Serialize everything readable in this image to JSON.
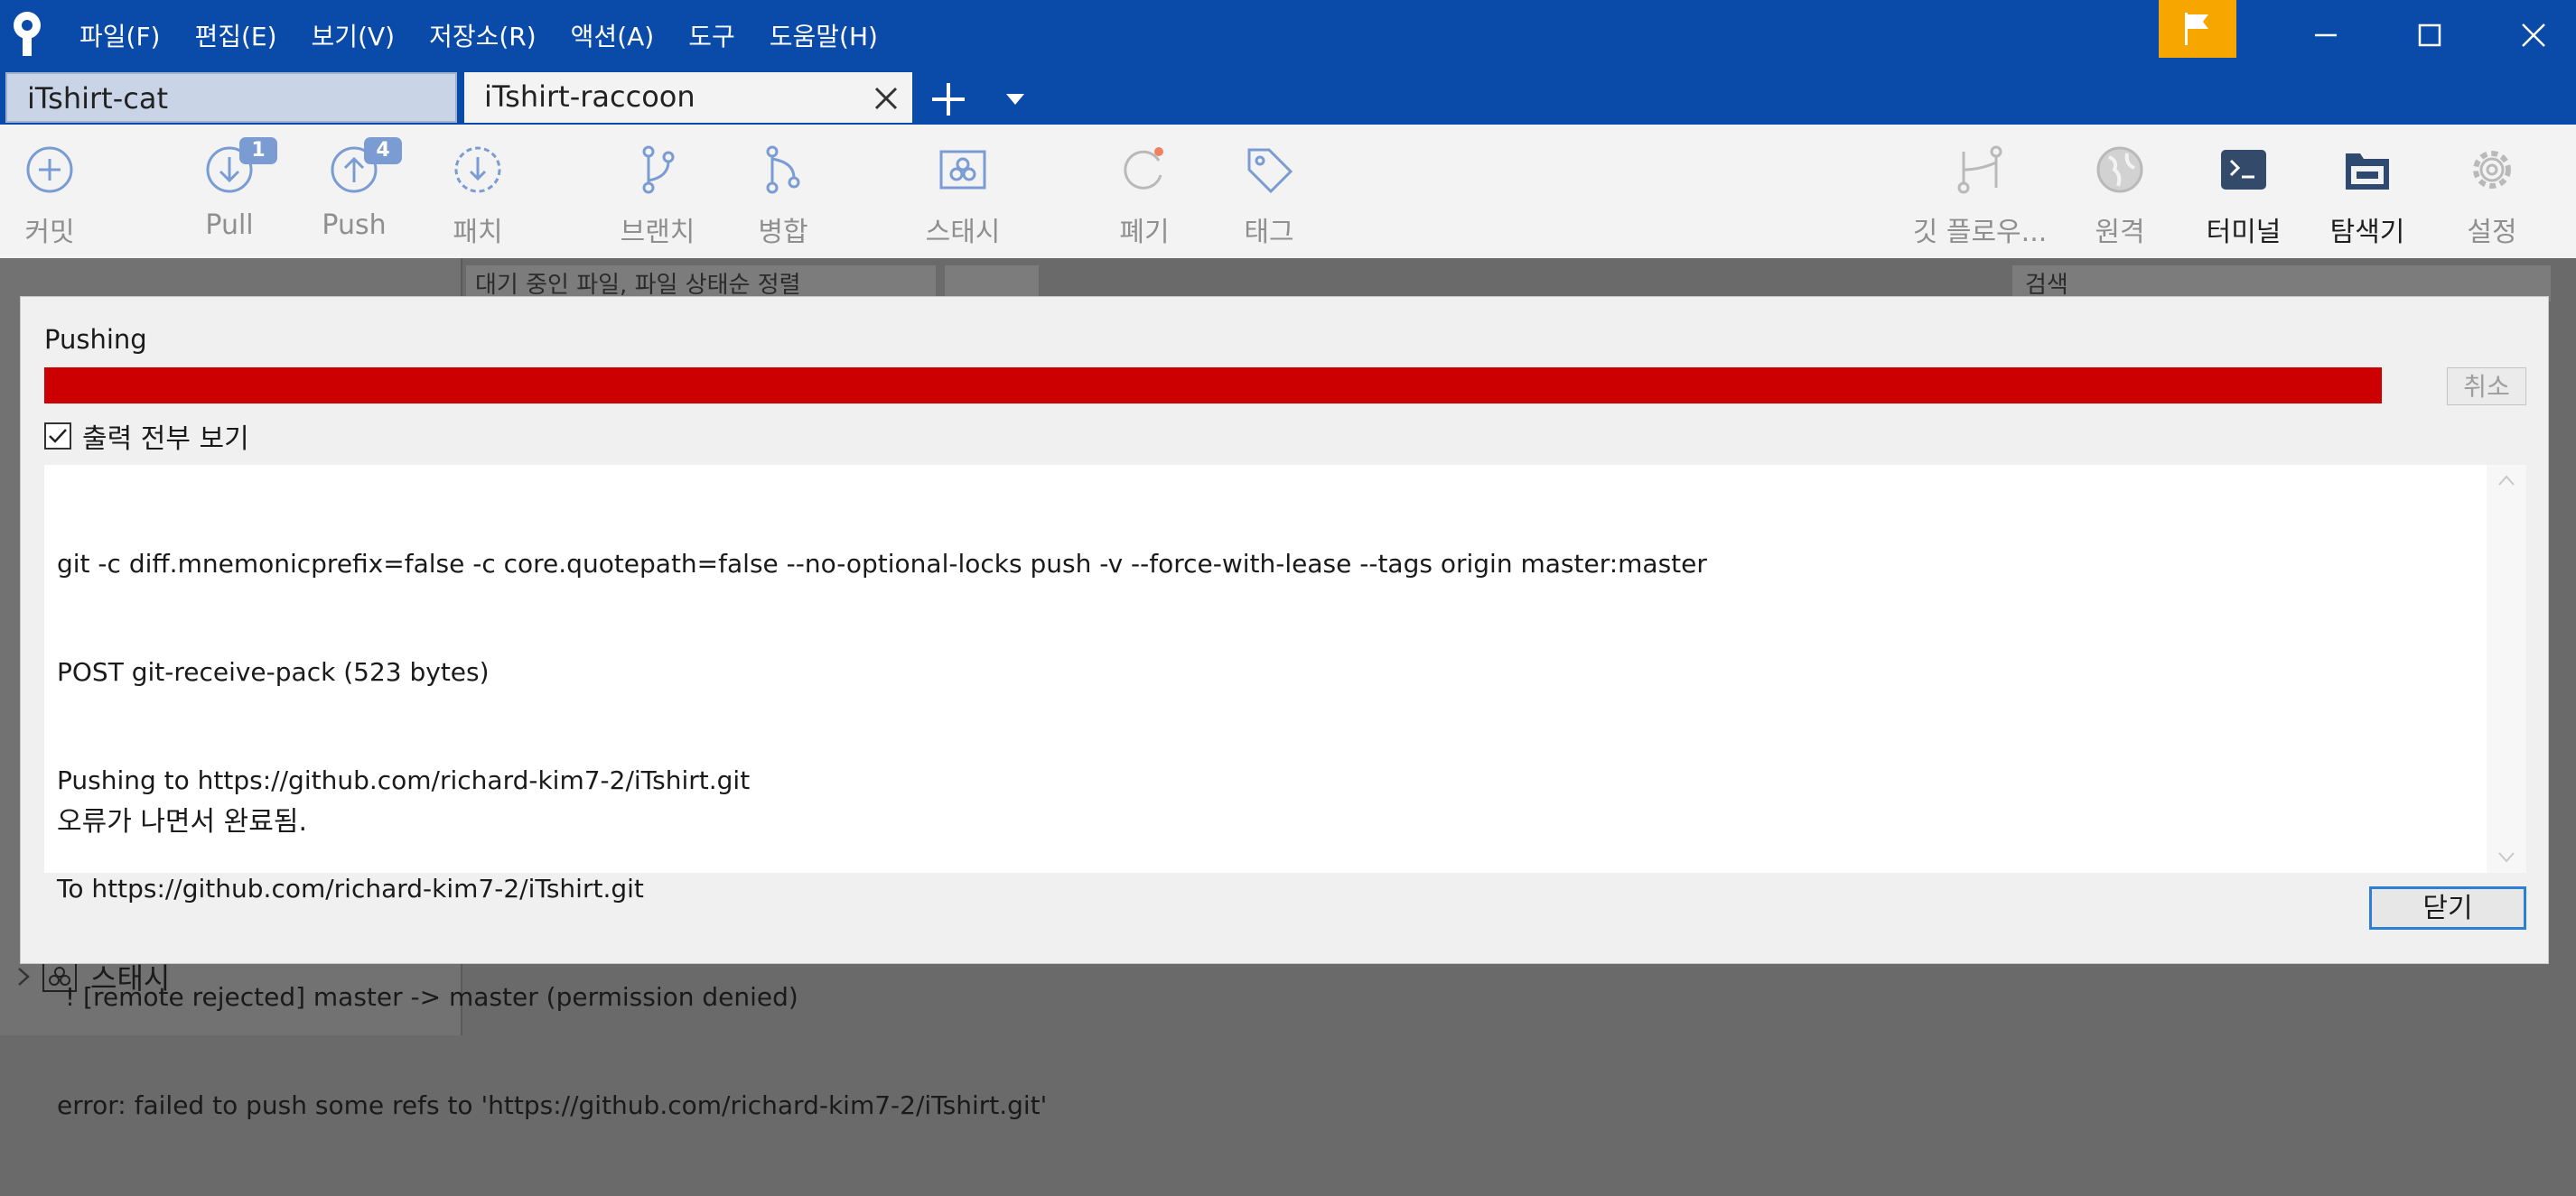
{
  "menu": {
    "items": [
      "파일(F)",
      "편집(E)",
      "보기(V)",
      "저장소(R)",
      "액션(A)",
      "도구",
      "도움말(H)"
    ]
  },
  "tabs": {
    "items": [
      {
        "label": "iTshirt-cat",
        "active": false
      },
      {
        "label": "iTshirt-raccoon",
        "active": true
      }
    ]
  },
  "toolbar": {
    "commit": "커밋",
    "pull": "Pull",
    "pull_badge": "1",
    "push": "Push",
    "push_badge": "4",
    "patch": "패치",
    "branch": "브랜치",
    "merge": "병합",
    "stash": "스태시",
    "discard": "폐기",
    "tag": "태그",
    "git_flow": "깃 플로우...",
    "remote": "원격",
    "terminal": "터미널",
    "explorer": "탐색기",
    "settings": "설정"
  },
  "background": {
    "filter_label": "대기 중인 파일, 파일 상태순 정렬",
    "search_placeholder": "검색",
    "sidebar_stash": "스태시"
  },
  "dialog": {
    "title": "Pushing",
    "progress": 1.0,
    "progress_color": "#cc0000",
    "cancel_label": "취소",
    "show_output_label": "출력 전부 보기",
    "show_output_checked": true,
    "output_lines": [
      "git -c diff.mnemonicprefix=false -c core.quotepath=false --no-optional-locks push -v --force-with-lease --tags origin master:master",
      "POST git-receive-pack (523 bytes)",
      "Pushing to https://github.com/richard-kim7-2/iTshirt.git",
      "To https://github.com/richard-kim7-2/iTshirt.git",
      " ! [remote rejected] master -> master (permission denied)",
      "error: failed to push some refs to 'https://github.com/richard-kim7-2/iTshirt.git'"
    ],
    "status": "오류가 나면서 완료됨.",
    "close_label": "닫기"
  },
  "colors": {
    "title_bar": "#0a4aa8",
    "flag_button": "#f7a600",
    "accent": "#2d7fd6"
  }
}
